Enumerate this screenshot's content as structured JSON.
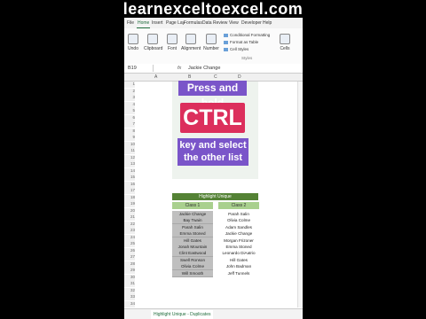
{
  "banner": "learnexceltoexcel.com",
  "ribbon_tabs": [
    "File",
    "Home",
    "Insert",
    "Page Lay",
    "Formulas",
    "Data",
    "Review",
    "View",
    "Developer",
    "Help"
  ],
  "ribbon": {
    "undo": "Undo",
    "clipboard": "Clipboard",
    "font": "Font",
    "alignment": "Alignment",
    "number": "Number",
    "cond_formatting": "Conditional Formatting",
    "format_table": "Format as Table",
    "cell_styles": "Cell Styles",
    "styles": "Styles",
    "cells": "Cells"
  },
  "formula_bar": {
    "name_box": "B19",
    "fx": "fx",
    "value": "Jackie Change"
  },
  "columns": [
    "A",
    "B",
    "C",
    "D"
  ],
  "callouts": {
    "line1": "Press and hold",
    "line2": "CTRL",
    "line3a": "key and select",
    "line3b": "the other list"
  },
  "table": {
    "title": "Highlight Unique",
    "col1_header": "Class 1",
    "col2_header": "Class 2",
    "class1": [
      "Jackie Change",
      "Bay Twain",
      "Parah Salin",
      "Emma Stoned",
      "Hill Gates",
      "Jonah Mountain",
      "Clint Eastwood",
      "Swell Ronson",
      "Olivia Colme",
      "Will Smooth"
    ],
    "class2": [
      "Parah Salin",
      "Olivia Colme",
      "Adam Sandles",
      "Jackie Change",
      "Morgan Frizoner",
      "Emma Stoned",
      "Leonardo DiAatrio",
      "Hill Gates",
      "John Badman",
      "Jeff Tunnels"
    ]
  },
  "rows": [
    "1",
    "2",
    "3",
    "4",
    "5",
    "6",
    "7",
    "8",
    "9",
    "10",
    "11",
    "12",
    "13",
    "14",
    "15",
    "16",
    "17",
    "18",
    "19",
    "20",
    "21",
    "22",
    "23",
    "24",
    "25",
    "26",
    "27",
    "28",
    "29",
    "30",
    "31",
    "32",
    "33",
    "34"
  ],
  "sheet_tab": "Highlight Unique - Duplicates"
}
